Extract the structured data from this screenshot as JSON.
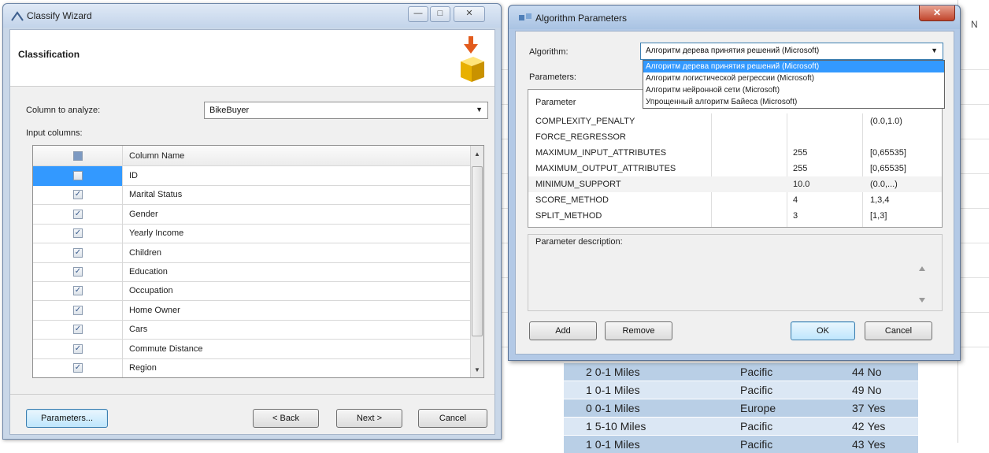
{
  "background_sheet": {
    "column_header_fragment": "N",
    "rows": [
      {
        "num": "2",
        "commute": "0-1 Miles",
        "region": "Pacific",
        "age": "44",
        "buyer": "No"
      },
      {
        "num": "1",
        "commute": "0-1 Miles",
        "region": "Pacific",
        "age": "49",
        "buyer": "No"
      },
      {
        "num": "0",
        "commute": "0-1 Miles",
        "region": "Europe",
        "age": "37",
        "buyer": "Yes"
      },
      {
        "num": "1",
        "commute": "5-10 Miles",
        "region": "Pacific",
        "age": "42",
        "buyer": "Yes"
      },
      {
        "num": "1",
        "commute": "0-1 Miles",
        "region": "Pacific",
        "age": "43",
        "buyer": "Yes"
      }
    ]
  },
  "wizard": {
    "title": "Classify Wizard",
    "controls": {
      "minimize": "—",
      "maximize": "□",
      "close": "✕"
    },
    "header_title": "Classification",
    "column_to_analyze_label": "Column to analyze:",
    "column_to_analyze_value": "BikeBuyer",
    "input_columns_label": "Input columns:",
    "grid_header": "Column Name",
    "columns": [
      {
        "name": "ID",
        "checked": false,
        "selected": true
      },
      {
        "name": "Marital Status",
        "checked": true
      },
      {
        "name": "Gender",
        "checked": true
      },
      {
        "name": "Yearly Income",
        "checked": true
      },
      {
        "name": "Children",
        "checked": true
      },
      {
        "name": "Education",
        "checked": true
      },
      {
        "name": "Occupation",
        "checked": true
      },
      {
        "name": "Home Owner",
        "checked": true
      },
      {
        "name": "Cars",
        "checked": true
      },
      {
        "name": "Commute Distance",
        "checked": true
      },
      {
        "name": "Region",
        "checked": true
      }
    ],
    "buttons": {
      "parameters": "Parameters...",
      "back": "< Back",
      "next": "Next >",
      "cancel": "Cancel"
    }
  },
  "algo": {
    "title": "Algorithm Parameters",
    "close": "✕",
    "algorithm_label": "Algorithm:",
    "algorithm_value": "Алгоритм дерева принятия решений (Microsoft)",
    "dropdown_options": [
      "Алгоритм дерева принятия решений (Microsoft)",
      "Алгоритм логистической регрессии (Microsoft)",
      "Алгоритм нейронной сети (Microsoft)",
      "Упрощенный алгоритм Байеса (Microsoft)"
    ],
    "parameters_label": "Parameters:",
    "table_header": "Parameter",
    "params": [
      {
        "name": "COMPLEXITY_PENALTY",
        "value": "",
        "range": "(0.0,1.0)"
      },
      {
        "name": "FORCE_REGRESSOR",
        "value": "",
        "range": ""
      },
      {
        "name": "MAXIMUM_INPUT_ATTRIBUTES",
        "value": "255",
        "range": "[0,65535]"
      },
      {
        "name": "MAXIMUM_OUTPUT_ATTRIBUTES",
        "value": "255",
        "range": "[0,65535]"
      },
      {
        "name": "MINIMUM_SUPPORT",
        "value": "10.0",
        "range": "(0.0,...)"
      },
      {
        "name": "SCORE_METHOD",
        "value": "4",
        "range": "1,3,4"
      },
      {
        "name": "SPLIT_METHOD",
        "value": "3",
        "range": "[1,3]"
      }
    ],
    "description_label": "Parameter description:",
    "buttons": {
      "add": "Add",
      "remove": "Remove",
      "ok": "OK",
      "cancel": "Cancel"
    }
  },
  "colors": {
    "selection": "#3399ff",
    "sheet_band": "#b9cfe6",
    "close_red": "#c0442b"
  }
}
